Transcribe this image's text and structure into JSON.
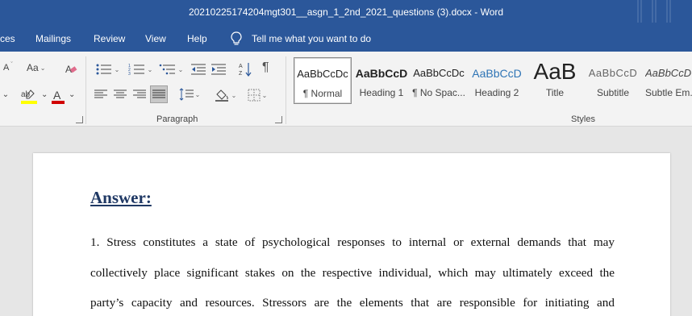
{
  "titlebar": {
    "title": "20210225174204mgt301__asgn_1_2nd_2021_questions (3).docx  -  Word"
  },
  "menu": {
    "items": [
      "ces",
      "Mailings",
      "Review",
      "View",
      "Help"
    ],
    "tell_me": "Tell me what you want to do"
  },
  "ribbon": {
    "font_group": {
      "change_case": "Aa",
      "font_color_letter": "A",
      "highlight_letters": "ab"
    },
    "paragraph_group": {
      "label": "Paragraph",
      "pilcrow": "¶"
    },
    "styles_group": {
      "label": "Styles",
      "items": [
        {
          "sample": "AaBbCcDc",
          "name": "¶ Normal"
        },
        {
          "sample": "AaBbCcD",
          "name": "Heading 1"
        },
        {
          "sample": "AaBbCcDc",
          "name": "¶ No Spac..."
        },
        {
          "sample": "AaBbCcD",
          "name": "Heading 2"
        },
        {
          "sample": "AaB",
          "name": "Title"
        },
        {
          "sample": "AaBbCcD",
          "name": "Subtitle"
        },
        {
          "sample": "AaBbCcD",
          "name": "Subtle Em..."
        }
      ]
    },
    "colors": {
      "highlight": "#ffff00",
      "font_color": "#d00000"
    }
  },
  "document": {
    "heading": "Answer:",
    "lines": [
      "1. Stress constitutes a state of psychological responses to internal or external demands that may",
      "collectively place significant stakes on the respective individual, which may ultimately exceed the",
      "party’s capacity and resources. Stressors are the elements that are responsible for initiating and"
    ]
  }
}
